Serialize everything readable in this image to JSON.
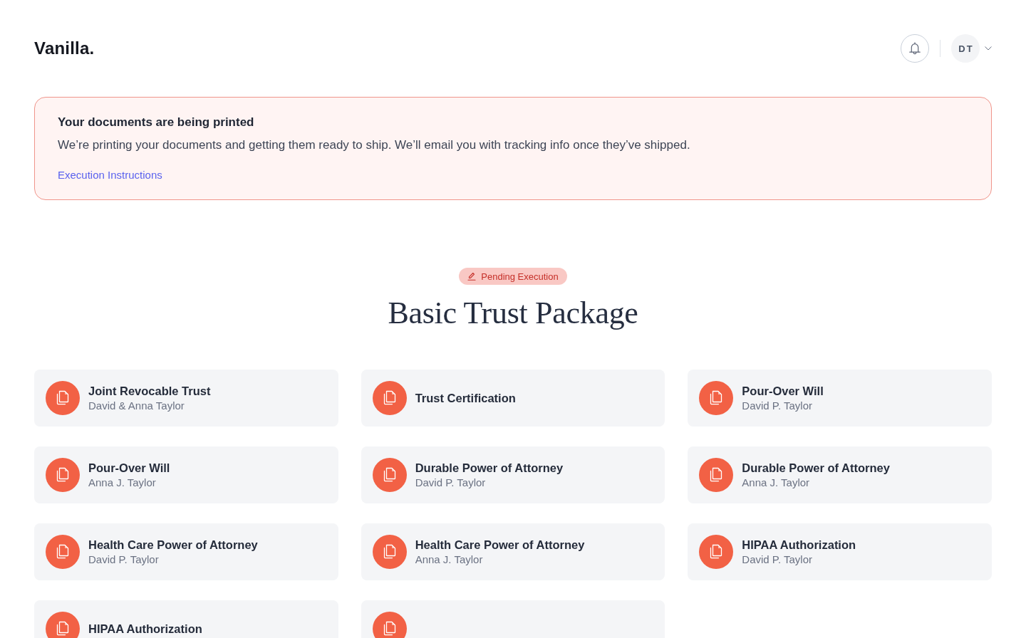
{
  "header": {
    "logo": "Vanilla.",
    "avatar_initials": "DT"
  },
  "banner": {
    "title": "Your documents are being printed",
    "message": "We’re printing your documents and getting them ready to ship. We’ll email you with tracking info once they’ve shipped.",
    "link": "Execution Instructions"
  },
  "package": {
    "status": "Pending Execution",
    "title": "Basic Trust Package"
  },
  "documents": [
    {
      "kind": "document",
      "title": "Joint Revocable Trust",
      "subtitle": "David & Anna Taylor"
    },
    {
      "kind": "document",
      "title": "Trust Certification"
    },
    {
      "kind": "document",
      "title": "Pour-Over Will",
      "subtitle": "David P. Taylor"
    },
    {
      "kind": "document",
      "title": "Pour-Over Will",
      "subtitle": "Anna J. Taylor"
    },
    {
      "kind": "document",
      "title": "Durable Power of Attorney",
      "subtitle": "David P. Taylor"
    },
    {
      "kind": "document",
      "title": "Durable Power of Attorney",
      "subtitle": "Anna J. Taylor"
    },
    {
      "kind": "document",
      "title": "Health Care Power of Attorney",
      "subtitle": "David P. Taylor"
    },
    {
      "kind": "document",
      "title": "Health Care Power of Attorney",
      "subtitle": "Anna J. Taylor"
    },
    {
      "kind": "document",
      "title": "HIPAA Authorization",
      "subtitle": "David P. Taylor"
    },
    {
      "kind": "document",
      "title": "HIPAA Authorization"
    },
    {
      "kind": "document"
    }
  ]
}
